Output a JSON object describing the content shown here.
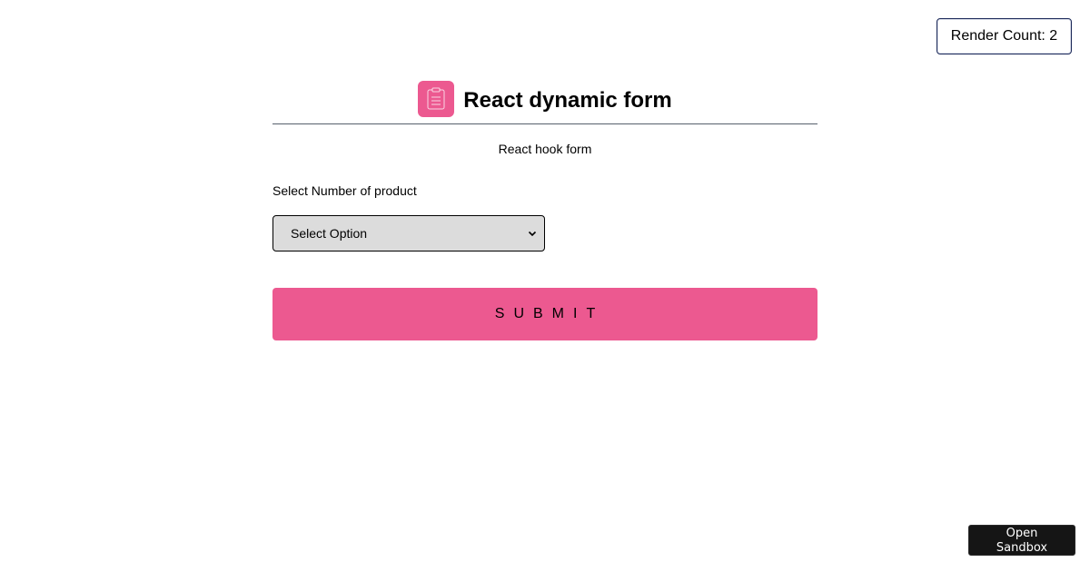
{
  "render_count": {
    "label": "Render Count: 2"
  },
  "header": {
    "logo_icon": "clipboard-icon",
    "title": "React dynamic form",
    "subtitle": "React hook form"
  },
  "form": {
    "field_label": "Select Number of product",
    "select": {
      "selected_value": "Select Option"
    },
    "submit_label": "SUBMIT"
  },
  "sandbox": {
    "label": "Open Sandbox"
  },
  "colors": {
    "accent": "#ec5990",
    "select_bg": "#dcdcdc",
    "sandbox_bg": "#151515"
  }
}
